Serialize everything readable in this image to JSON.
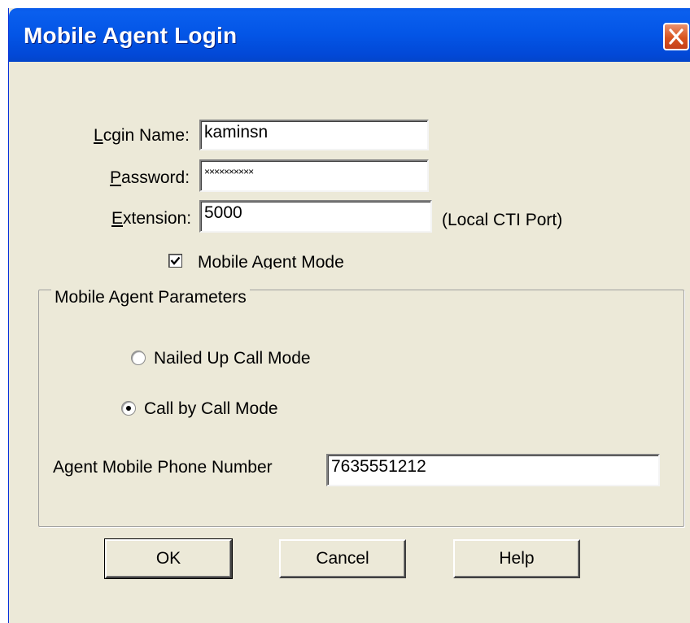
{
  "window": {
    "title": "Mobile Agent Login"
  },
  "form": {
    "login_name_label_first": "L",
    "login_name_label_rest": "cgin Name:",
    "login_name_value": "kaminsn",
    "password_label_first": "P",
    "password_label_rest": "assword:",
    "password_value": "××××××××××",
    "extension_label_first": "E",
    "extension_label_rest": "xtension:",
    "extension_value": "5000",
    "extension_note": "(Local CTI Port)",
    "mobile_agent_mode_label": "Mobile Agent Mode",
    "mobile_agent_mode_checked": true
  },
  "parameters": {
    "group_title": "Mobile Agent Parameters",
    "nailed_up_label": "Nailed Up Call Mode",
    "nailed_up_selected": false,
    "call_by_call_label": "Call by Call Mode",
    "call_by_call_selected": true,
    "phone_label": "Agent Mobile Phone Number",
    "phone_value": "7635551212"
  },
  "buttons": {
    "ok": "OK",
    "cancel": "Cancel",
    "help": "Help"
  },
  "colors": {
    "titlebar": "#0355E6",
    "dialog_bg": "#ECE9D8",
    "close_button": "#D9541F"
  }
}
